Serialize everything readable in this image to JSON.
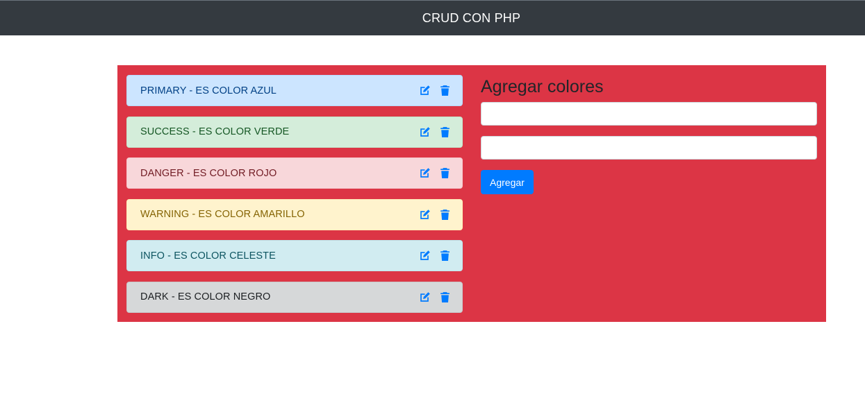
{
  "navbar": {
    "title": "CRUD CON PHP"
  },
  "colors": {
    "navbar_bg": "#343a40",
    "panel_bg": "#dc3545",
    "icon": "#007bff",
    "button": "#007bff"
  },
  "items": [
    {
      "label": "PRIMARY - ES COLOR AZUL",
      "bg": "#cce5ff",
      "fg": "#004085",
      "border": "#b8daff"
    },
    {
      "label": "SUCCESS - ES COLOR VERDE",
      "bg": "#d4edda",
      "fg": "#155724",
      "border": "#c3e6cb"
    },
    {
      "label": "DANGER - ES COLOR ROJO",
      "bg": "#f8d7da",
      "fg": "#721c24",
      "border": "#f5c6cb"
    },
    {
      "label": "WARNING - ES COLOR AMARILLO",
      "bg": "#fff3cd",
      "fg": "#856404",
      "border": "#ffeeba"
    },
    {
      "label": "INFO - ES COLOR CELESTE",
      "bg": "#d1ecf1",
      "fg": "#0c5460",
      "border": "#bee5eb"
    },
    {
      "label": "DARK - ES COLOR NEGRO",
      "bg": "#d6d8d9",
      "fg": "#1b1e21",
      "border": "#c6c8ca"
    }
  ],
  "item_icons": [
    "edit-icon",
    "trash-icon"
  ],
  "form": {
    "title": "Agregar colores",
    "color_input": {
      "value": "",
      "placeholder": ""
    },
    "description_input": {
      "value": "",
      "placeholder": ""
    },
    "submit_label": "Agregar"
  }
}
